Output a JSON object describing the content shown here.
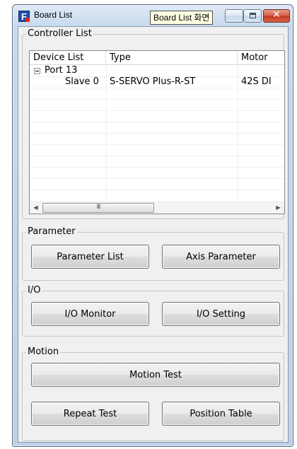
{
  "window": {
    "title": "Board List",
    "tooltip": "Board List 화면"
  },
  "controller_list": {
    "group_label": "Controller List",
    "columns": [
      "Device List",
      "Type",
      "Motor"
    ],
    "rows": [
      {
        "device": "Port 13",
        "type": "",
        "motor": ""
      },
      {
        "device": "Slave 0",
        "type": "S-SERVO Plus-R-ST",
        "motor": "42S DI"
      }
    ],
    "scroll_thumb_grip": "III"
  },
  "parameter": {
    "group_label": "Parameter",
    "parameter_list_label": "Parameter List",
    "axis_parameter_label": "Axis Parameter"
  },
  "io": {
    "group_label": "I/O",
    "io_monitor_label": "I/O Monitor",
    "io_setting_label": "I/O Setting"
  },
  "motion": {
    "group_label": "Motion",
    "motion_test_label": "Motion Test",
    "repeat_test_label": "Repeat Test",
    "position_table_label": "Position Table"
  },
  "icons": {
    "app": "app-logo-icon",
    "minimize": "minimize-icon",
    "maximize": "maximize-icon",
    "close": "close-icon",
    "collapse": "collapse-minus-icon",
    "scroll_left": "scroll-left-arrow-icon",
    "scroll_right": "scroll-right-arrow-icon"
  },
  "colors": {
    "close_button": "#c2381f",
    "tooltip_bg": "#ffffe1",
    "window_frame": "#bdd0e8",
    "client_bg": "#f0f0f0"
  }
}
